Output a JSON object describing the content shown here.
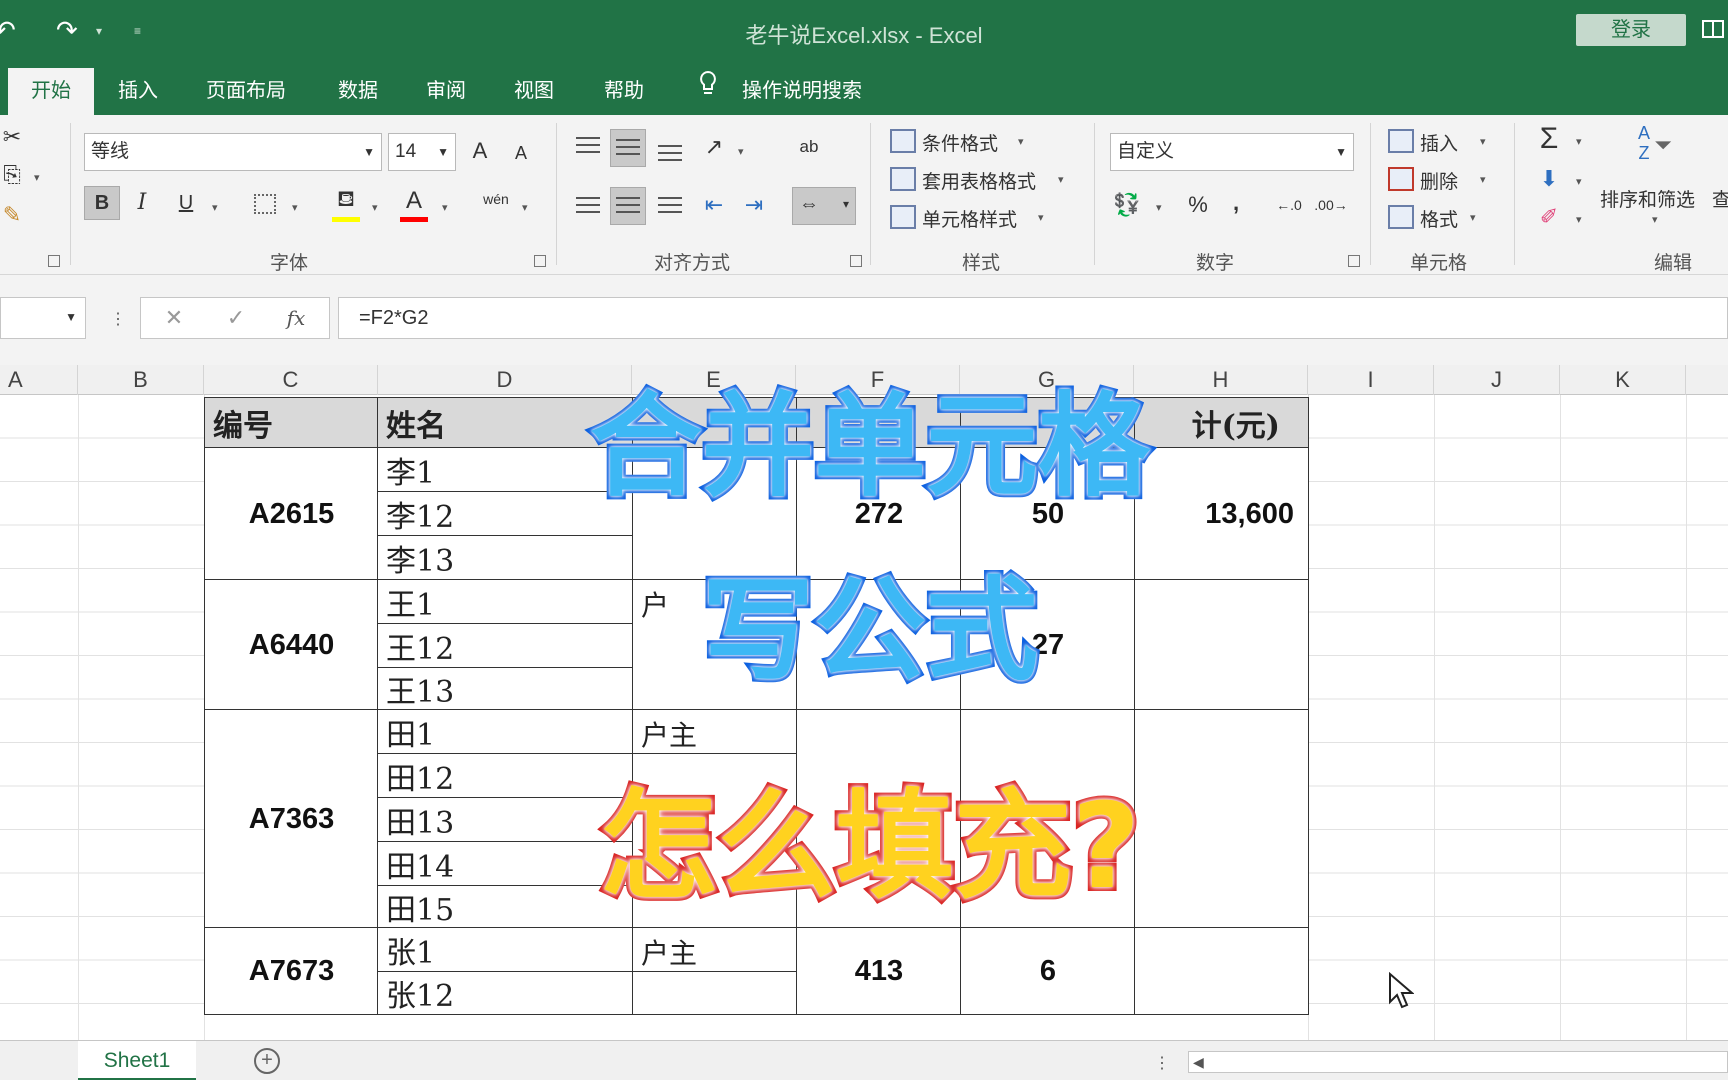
{
  "titlebar": {
    "title": "老牛说Excel.xlsx  -  Excel",
    "login_label": "登录",
    "colors": {
      "excel_green": "#217346"
    }
  },
  "ribbon_tabs": [
    "开始",
    "插入",
    "页面布局",
    "数据",
    "审阅",
    "视图",
    "帮助"
  ],
  "tell_me": "操作说明搜索",
  "ribbon": {
    "font_name": "等线",
    "font_size": "14",
    "grow_font": "A",
    "shrink_font": "A",
    "bold": "B",
    "italic": "I",
    "underline": "U",
    "font_color_glyph": "A",
    "phonetic_glyph": "wén",
    "wrap_glyph": "ab",
    "conditional_format": "条件格式",
    "format_as_table": "套用表格格式",
    "cell_styles": "单元格样式",
    "number_format": "自定义",
    "percent": "%",
    "comma": ",",
    "insert": "插入",
    "delete": "删除",
    "format": "格式",
    "sum_glyph": "Σ",
    "sort_filter": "排序和筛选",
    "find_cut": "查",
    "groups": {
      "font": "字体",
      "alignment": "对齐方式",
      "styles": "样式",
      "number": "数字",
      "cells": "单元格",
      "editing": "编辑"
    }
  },
  "formula_bar": {
    "cancel": "✕",
    "enter": "✓",
    "fx": "fx",
    "formula": "=F2*G2"
  },
  "column_headers": [
    "A",
    "B",
    "C",
    "D",
    "E",
    "F",
    "G",
    "H",
    "I",
    "J",
    "K"
  ],
  "table": {
    "headers": {
      "id": "编号",
      "name": "姓名",
      "amount": "计(元)"
    },
    "rows_names": [
      "李1",
      "李12",
      "李13",
      "王1",
      "王12",
      "王13",
      "田1",
      "田12",
      "田13",
      "田14",
      "田15",
      "张1",
      "张12"
    ],
    "groups": [
      {
        "id": "A2615",
        "col_f": "272",
        "col_g": "50",
        "amount": "13,600"
      },
      {
        "id": "A6440",
        "role": "户",
        "col_g": "27"
      },
      {
        "id": "A7363",
        "role": "户主"
      },
      {
        "id": "A7673",
        "role": "户主",
        "col_f": "413",
        "col_g": "6"
      }
    ]
  },
  "overlay": {
    "line1": "合并单元格",
    "line2": "写公式",
    "line3": "怎么填充?",
    "colors": {
      "blue_fill": "#3db8f5",
      "blue_stroke": "#0a5fe0",
      "yellow_fill": "#ffd21f",
      "red_stroke": "#d9201f"
    }
  },
  "sheet_tabs": [
    "Sheet1"
  ],
  "add_sheet": "+"
}
